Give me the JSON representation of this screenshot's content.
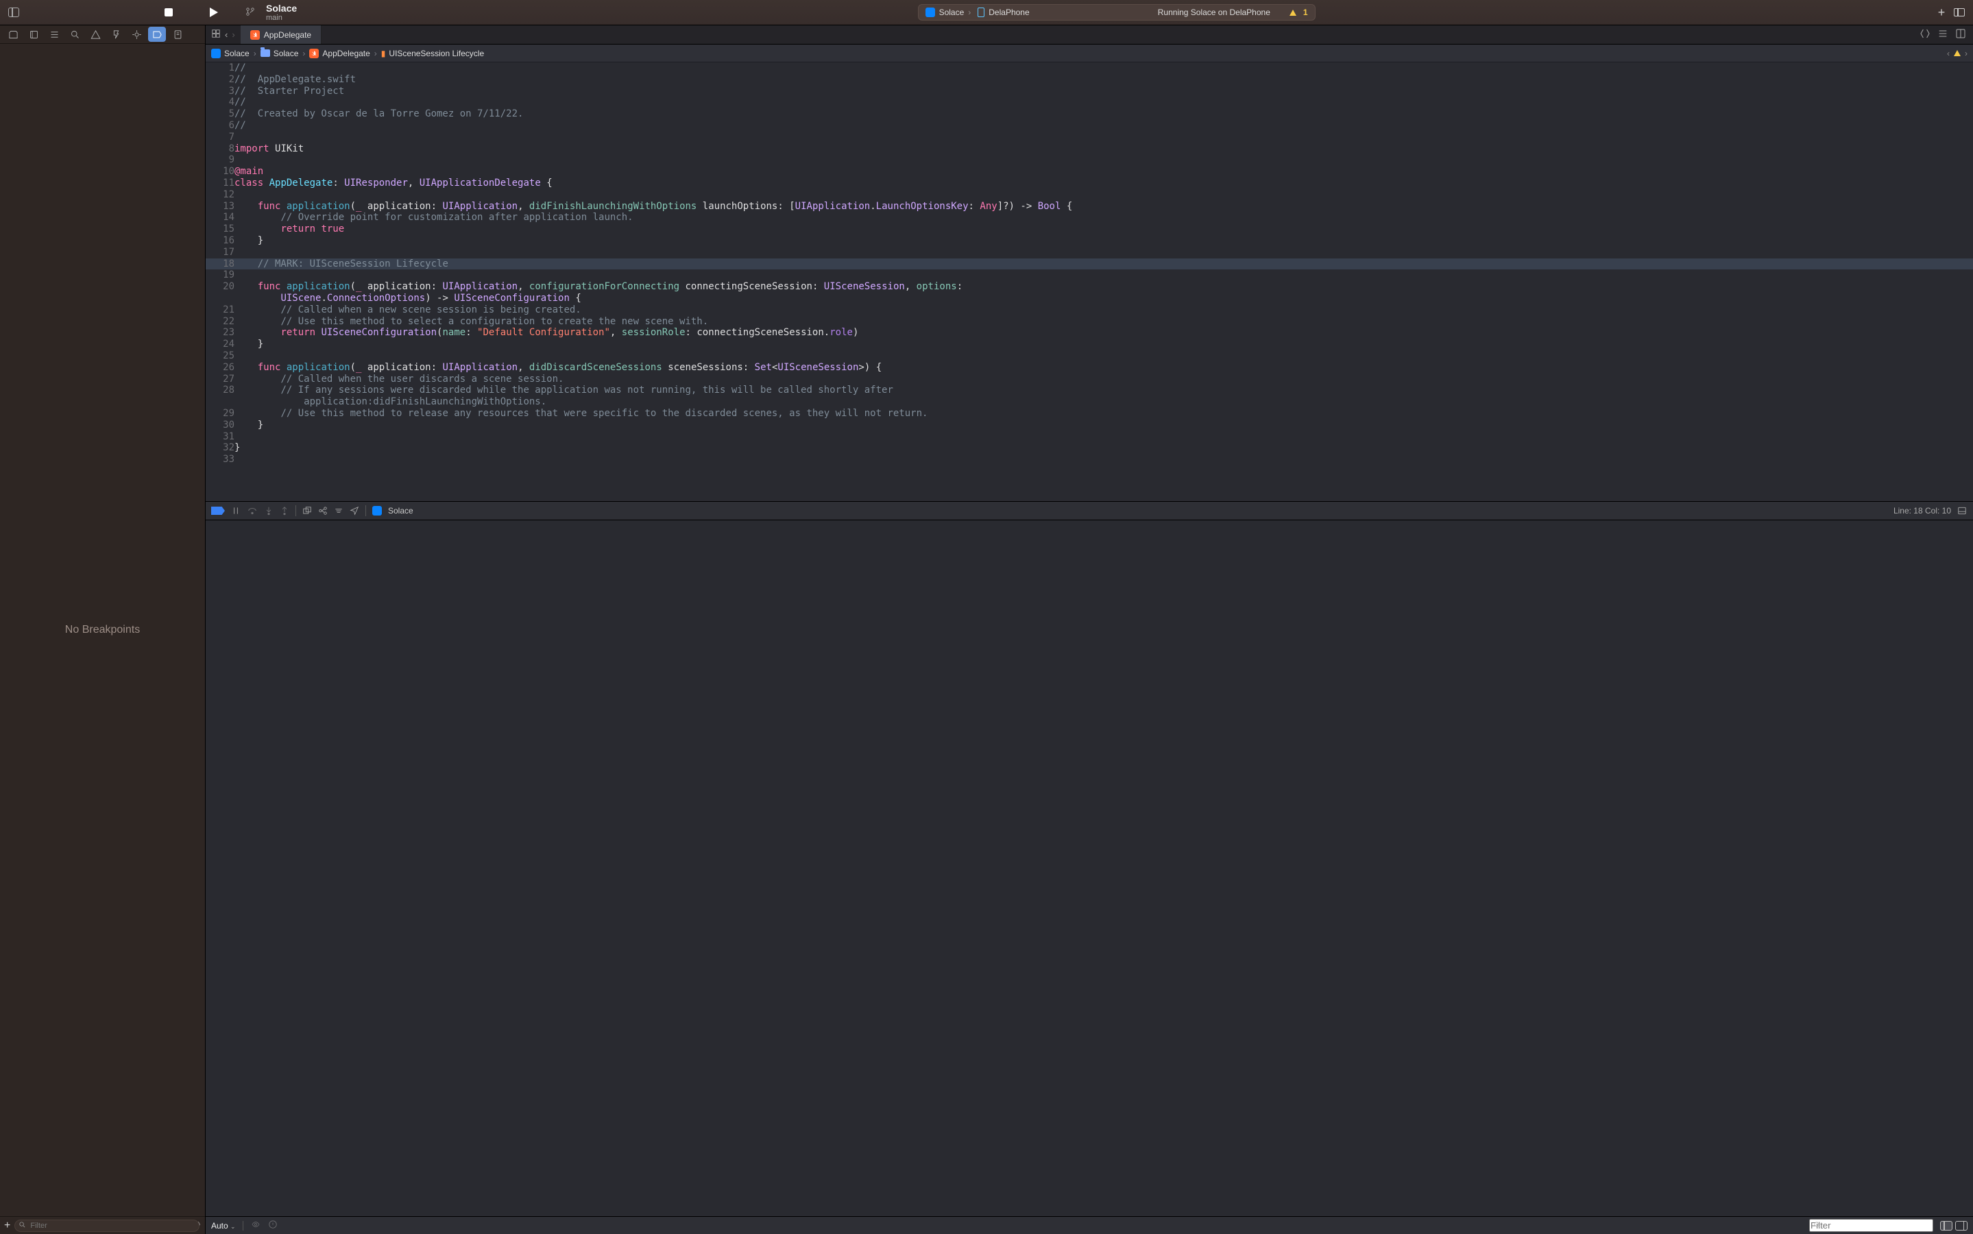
{
  "toolbar": {
    "project_name": "Solace",
    "branch": "main"
  },
  "status": {
    "scheme": "Solace",
    "destination": "DelaPhone",
    "running_text": "Running Solace on DelaPhone",
    "warning_count": "1"
  },
  "file_tab": {
    "name": "AppDelegate"
  },
  "jump_bar": {
    "items": [
      "Solace",
      "Solace",
      "AppDelegate",
      "UISceneSession Lifecycle"
    ]
  },
  "navigator": {
    "filter_placeholder": "Filter",
    "empty_text": "No Breakpoints"
  },
  "debug": {
    "executable": "Solace",
    "position_label": "Line: 18   Col: 10",
    "filter_placeholder": "Filter",
    "auto_label": "Auto"
  },
  "code_lines": [
    {
      "n": 1,
      "html": "<span class='tk-comment'>//</span>"
    },
    {
      "n": 2,
      "html": "<span class='tk-comment'>//  AppDelegate.swift</span>"
    },
    {
      "n": 3,
      "html": "<span class='tk-comment'>//  Starter Project</span>"
    },
    {
      "n": 4,
      "html": "<span class='tk-comment'>//</span>"
    },
    {
      "n": 5,
      "html": "<span class='tk-comment'>//  Created by Oscar de la Torre Gomez on 7/11/22.</span>"
    },
    {
      "n": 6,
      "html": "<span class='tk-comment'>//</span>"
    },
    {
      "n": 7,
      "html": ""
    },
    {
      "n": 8,
      "html": "<span class='tk-kw'>import</span> <span class='tk-plain'>UIKit</span>"
    },
    {
      "n": 9,
      "html": ""
    },
    {
      "n": 10,
      "html": "<span class='tk-kw'>@main</span>"
    },
    {
      "n": 11,
      "html": "<span class='tk-kw'>class</span> <span class='tk-decl'>AppDelegate</span><span class='tk-plain'>: </span><span class='tk-type2'>UIResponder</span><span class='tk-plain'>, </span><span class='tk-type2'>UIApplicationDelegate</span><span class='tk-plain'> {</span>"
    },
    {
      "n": 12,
      "html": ""
    },
    {
      "n": 13,
      "html": "    <span class='tk-kw'>func</span> <span class='tk-funcname'>application</span><span class='tk-plain'>(</span><span class='tk-kw'>_</span><span class='tk-plain'> application: </span><span class='tk-type2'>UIApplication</span><span class='tk-plain'>, </span><span class='tk-param'>didFinishLaunchingWithOptions</span><span class='tk-plain'> launchOptions: [</span><span class='tk-type2'>UIApplication</span><span class='tk-plain'>.</span><span class='tk-type2'>LaunchOptionsKey</span><span class='tk-plain'>: </span><span class='tk-kw'>Any</span><span class='tk-plain'>]?) -&gt; </span><span class='tk-type2'>Bool</span><span class='tk-plain'> {</span>"
    },
    {
      "n": 14,
      "html": "        <span class='tk-comment'>// Override point for customization after application launch.</span>"
    },
    {
      "n": 15,
      "html": "        <span class='tk-kw'>return</span> <span class='tk-kw'>true</span>"
    },
    {
      "n": 16,
      "html": "    <span class='tk-plain'>}</span>"
    },
    {
      "n": 17,
      "html": ""
    },
    {
      "n": 18,
      "hl": true,
      "html": "    <span class='tk-comment'>// MARK: UISceneSession Lifecycle</span>"
    },
    {
      "n": 19,
      "html": ""
    },
    {
      "n": 20,
      "html": "    <span class='tk-kw'>func</span> <span class='tk-funcname'>application</span><span class='tk-plain'>(</span><span class='tk-kw'>_</span><span class='tk-plain'> application: </span><span class='tk-type2'>UIApplication</span><span class='tk-plain'>, </span><span class='tk-param'>configurationForConnecting</span><span class='tk-plain'> connectingSceneSession: </span><span class='tk-type2'>UISceneSession</span><span class='tk-plain'>, </span><span class='tk-param'>options</span><span class='tk-plain'>:</span>"
    },
    {
      "n": 21,
      "nonum": true,
      "html": "        <span class='tk-type2'>UIScene</span><span class='tk-plain'>.</span><span class='tk-type2'>ConnectionOptions</span><span class='tk-plain'>) -&gt; </span><span class='tk-type2'>UISceneConfiguration</span><span class='tk-plain'> {</span>"
    },
    {
      "n": 21,
      "html": "        <span class='tk-comment'>// Called when a new scene session is being created.</span>"
    },
    {
      "n": 22,
      "html": "        <span class='tk-comment'>// Use this method to select a configuration to create the new scene with.</span>"
    },
    {
      "n": 23,
      "html": "        <span class='tk-kw'>return</span> <span class='tk-type2'>UISceneConfiguration</span><span class='tk-plain'>(</span><span class='tk-param'>name</span><span class='tk-plain'>: </span><span class='tk-str'>\"Default Configuration\"</span><span class='tk-plain'>, </span><span class='tk-param'>sessionRole</span><span class='tk-plain'>: connectingSceneSession.</span><span class='tk-ctx'>role</span><span class='tk-plain'>)</span>"
    },
    {
      "n": 24,
      "html": "    <span class='tk-plain'>}</span>"
    },
    {
      "n": 25,
      "html": ""
    },
    {
      "n": 26,
      "html": "    <span class='tk-kw'>func</span> <span class='tk-funcname'>application</span><span class='tk-plain'>(</span><span class='tk-kw'>_</span><span class='tk-plain'> application: </span><span class='tk-type2'>UIApplication</span><span class='tk-plain'>, </span><span class='tk-param'>didDiscardSceneSessions</span><span class='tk-plain'> sceneSessions: </span><span class='tk-type2'>Set</span><span class='tk-plain'>&lt;</span><span class='tk-type2'>UISceneSession</span><span class='tk-plain'>&gt;) {</span>"
    },
    {
      "n": 27,
      "html": "        <span class='tk-comment'>// Called when the user discards a scene session.</span>"
    },
    {
      "n": 28,
      "html": "        <span class='tk-comment'>// If any sessions were discarded while the application was not running, this will be called shortly after</span>"
    },
    {
      "n": 29,
      "nonum": true,
      "html": "            <span class='tk-comment'>application:didFinishLaunchingWithOptions.</span>"
    },
    {
      "n": 29,
      "html": "        <span class='tk-comment'>// Use this method to release any resources that were specific to the discarded scenes, as they will not return.</span>"
    },
    {
      "n": 30,
      "html": "    <span class='tk-plain'>}</span>"
    },
    {
      "n": 31,
      "html": ""
    },
    {
      "n": 32,
      "html": "<span class='tk-plain'>}</span>"
    },
    {
      "n": 33,
      "html": ""
    }
  ]
}
